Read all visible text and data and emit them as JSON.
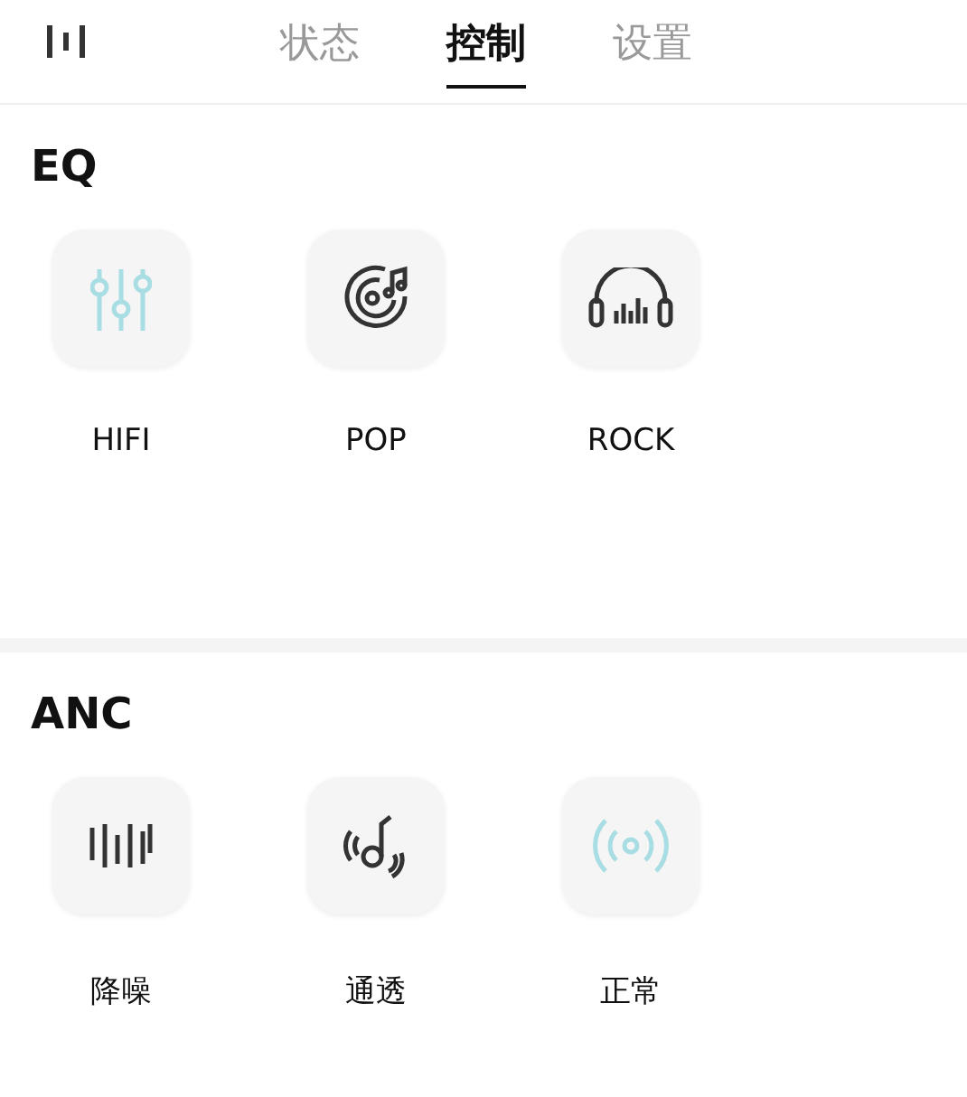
{
  "tabs": [
    {
      "label": "状态",
      "selected": false
    },
    {
      "label": "控制",
      "selected": true
    },
    {
      "label": "设置",
      "selected": false
    }
  ],
  "sections": [
    {
      "title": "EQ",
      "options": [
        {
          "label": "HIFI",
          "kind": "sliders",
          "selected": true
        },
        {
          "label": "POP",
          "kind": "vinyl",
          "selected": false
        },
        {
          "label": "ROCK",
          "kind": "headphones",
          "selected": false
        }
      ]
    },
    {
      "title": "ANC",
      "options": [
        {
          "label": "降噪",
          "kind": "bars",
          "selected": false
        },
        {
          "label": "通透",
          "kind": "transparency",
          "selected": false
        },
        {
          "label": "正常",
          "kind": "signal",
          "selected": true
        }
      ]
    }
  ]
}
